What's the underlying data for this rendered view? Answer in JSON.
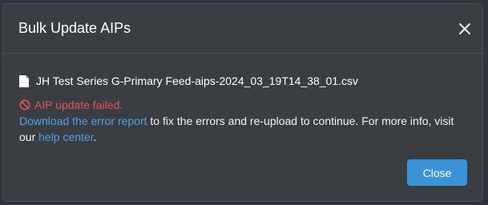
{
  "modal": {
    "title": "Bulk Update AIPs",
    "file_name": "JH Test Series G-Primary Feed-aips-2024_03_19T14_38_01.csv",
    "error_message": "AIP update failed.",
    "download_link": "Download the error report",
    "message_middle": " to fix the errors and re-upload to continue. For more info, visit our ",
    "help_link": "help center",
    "message_end": ".",
    "close_button": "Close"
  },
  "icons": {
    "close": "close-icon",
    "file": "file-icon",
    "error": "ban-icon"
  },
  "colors": {
    "error": "#e0545a",
    "link": "#4ea1e4",
    "primary_button": "#3a92d8"
  }
}
